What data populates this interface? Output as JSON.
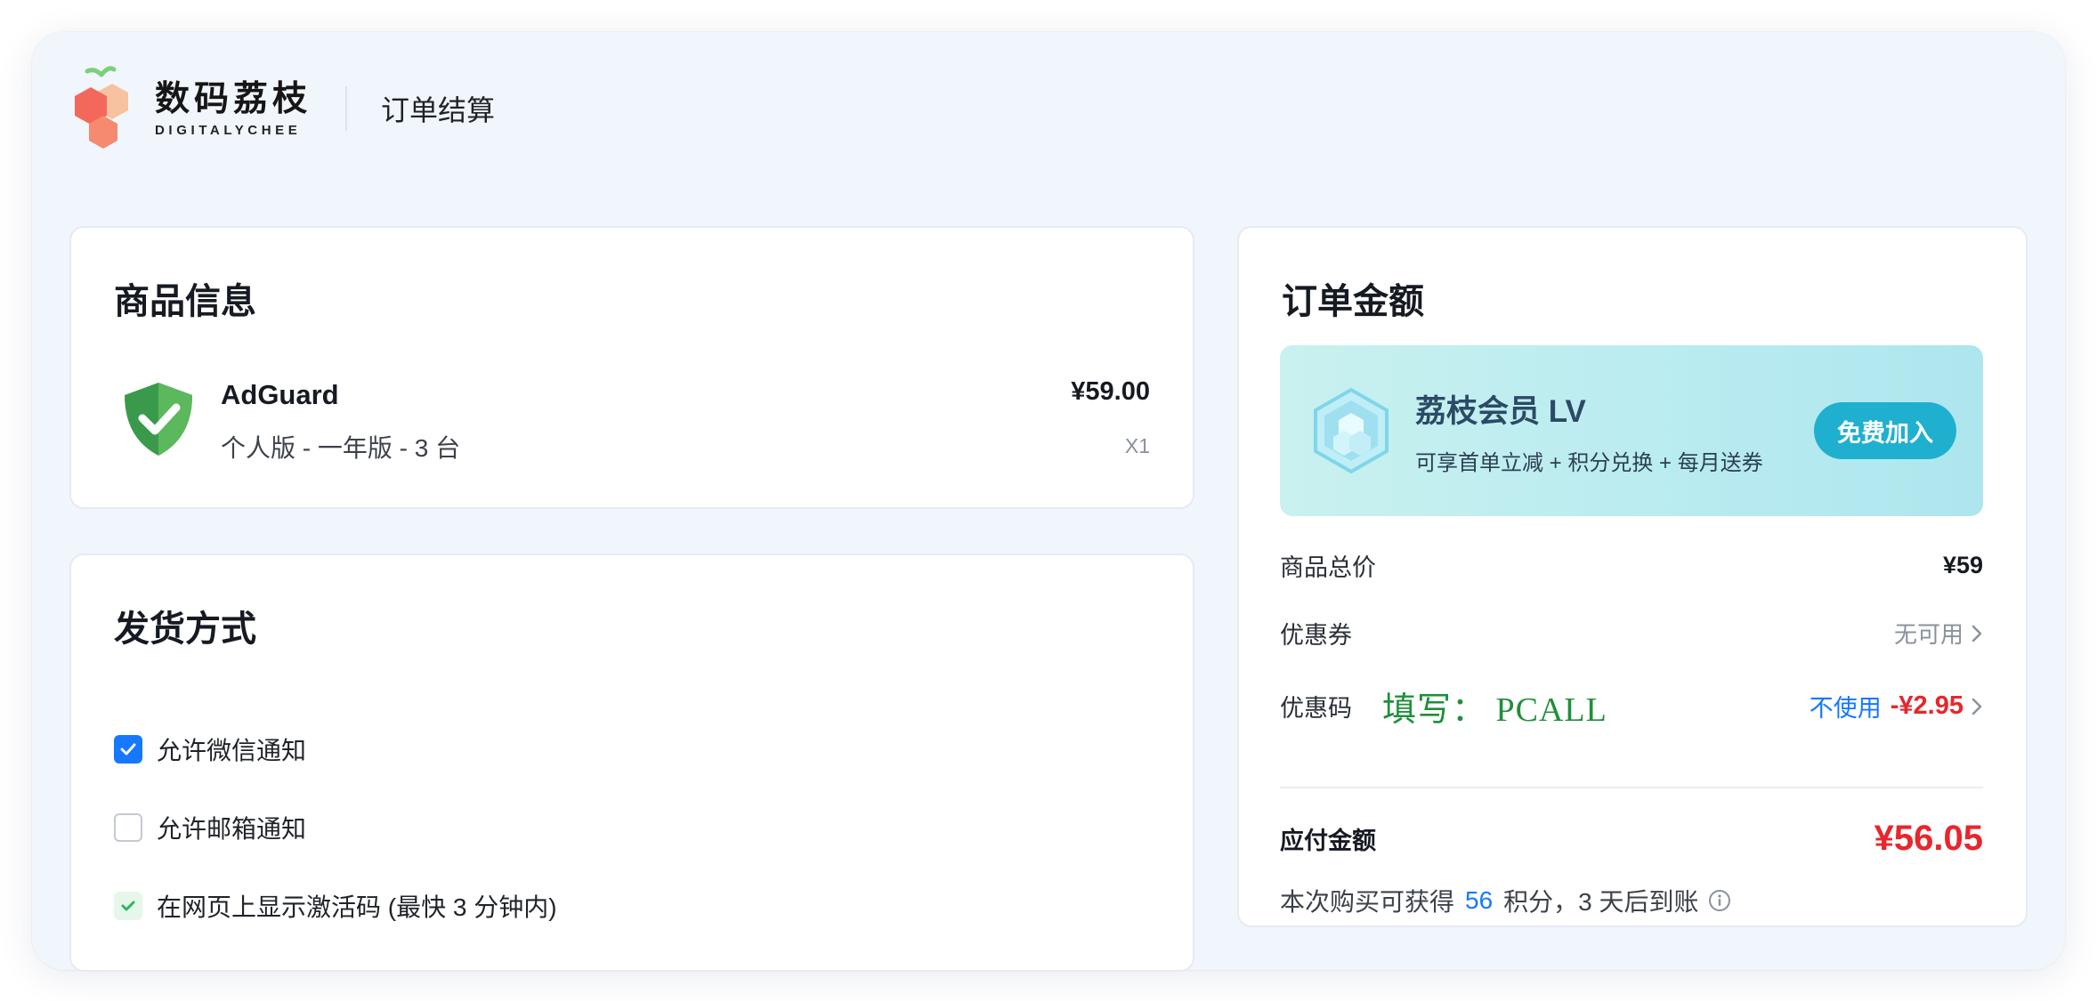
{
  "header": {
    "logo_cn": "数码荔枝",
    "logo_en": "DIGITALYCHEE",
    "title": "订单结算"
  },
  "product": {
    "section_title": "商品信息",
    "name": "AdGuard",
    "spec": "个人版 - 一年版 - 3 台",
    "price": "¥59.00",
    "quantity": "X1"
  },
  "delivery": {
    "section_title": "发货方式",
    "options": [
      {
        "label": "允许微信通知",
        "checked": true
      },
      {
        "label": "允许邮箱通知",
        "checked": false
      },
      {
        "label": "在网页上显示激活码 (最快 3 分钟内)",
        "checked": true
      }
    ]
  },
  "order": {
    "section_title": "订单金额",
    "member": {
      "title": "荔枝会员 LV",
      "subtitle": "可享首单立减 + 积分兑换 + 每月送券",
      "join_label": "免费加入"
    },
    "total_label": "商品总价",
    "total_value": "¥59",
    "coupon_label": "优惠券",
    "coupon_value": "无可用",
    "promo_label": "优惠码",
    "promo_hint": "填写： PCALL",
    "promo_no_use": "不使用",
    "promo_discount": "-¥2.95",
    "pay_label": "应付金额",
    "pay_value": "¥56.05",
    "points_prefix": "本次购买可获得",
    "points_value": "56",
    "points_suffix": "积分，3 天后到账"
  },
  "colors": {
    "accent_blue": "#1677ff",
    "price_red": "#e8262c",
    "promo_green": "#1f8f3a",
    "join_button": "#1fb0d0"
  }
}
